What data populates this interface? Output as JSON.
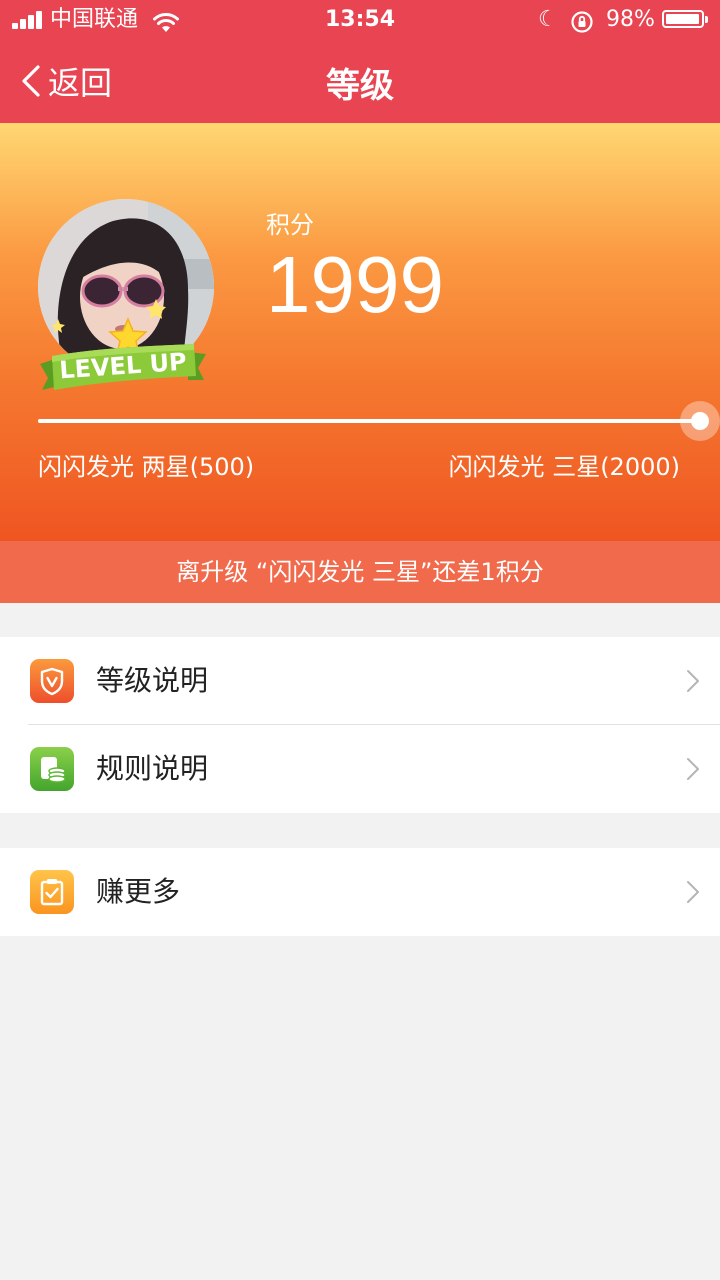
{
  "status_bar": {
    "carrier": "中国联通",
    "time": "13:54",
    "battery_percent": "98%",
    "battery_level": 0.98
  },
  "nav": {
    "back_label": "返回",
    "title": "等级"
  },
  "hero": {
    "badge_text": "LEVEL UP",
    "points_label": "积分",
    "points_value": "1999",
    "current_level": "闪闪发光 两星(500)",
    "next_level": "闪闪发光 三星(2000)",
    "progress": 1.0
  },
  "upgrade_hint": "离升级 “闪闪发光 三星”还差1积分",
  "menu": {
    "items": [
      {
        "label": "等级说明",
        "icon": "shield-v-icon"
      },
      {
        "label": "规则说明",
        "icon": "coins-icon"
      },
      {
        "label": "赚更多",
        "icon": "clipboard-check-icon"
      }
    ]
  },
  "colors": {
    "nav_bg": "#e84452",
    "hero_top": "#ffd772",
    "hero_bottom": "#ef5522",
    "hint_bg": "#f06a4b",
    "page_bg": "#f2f2f2"
  }
}
